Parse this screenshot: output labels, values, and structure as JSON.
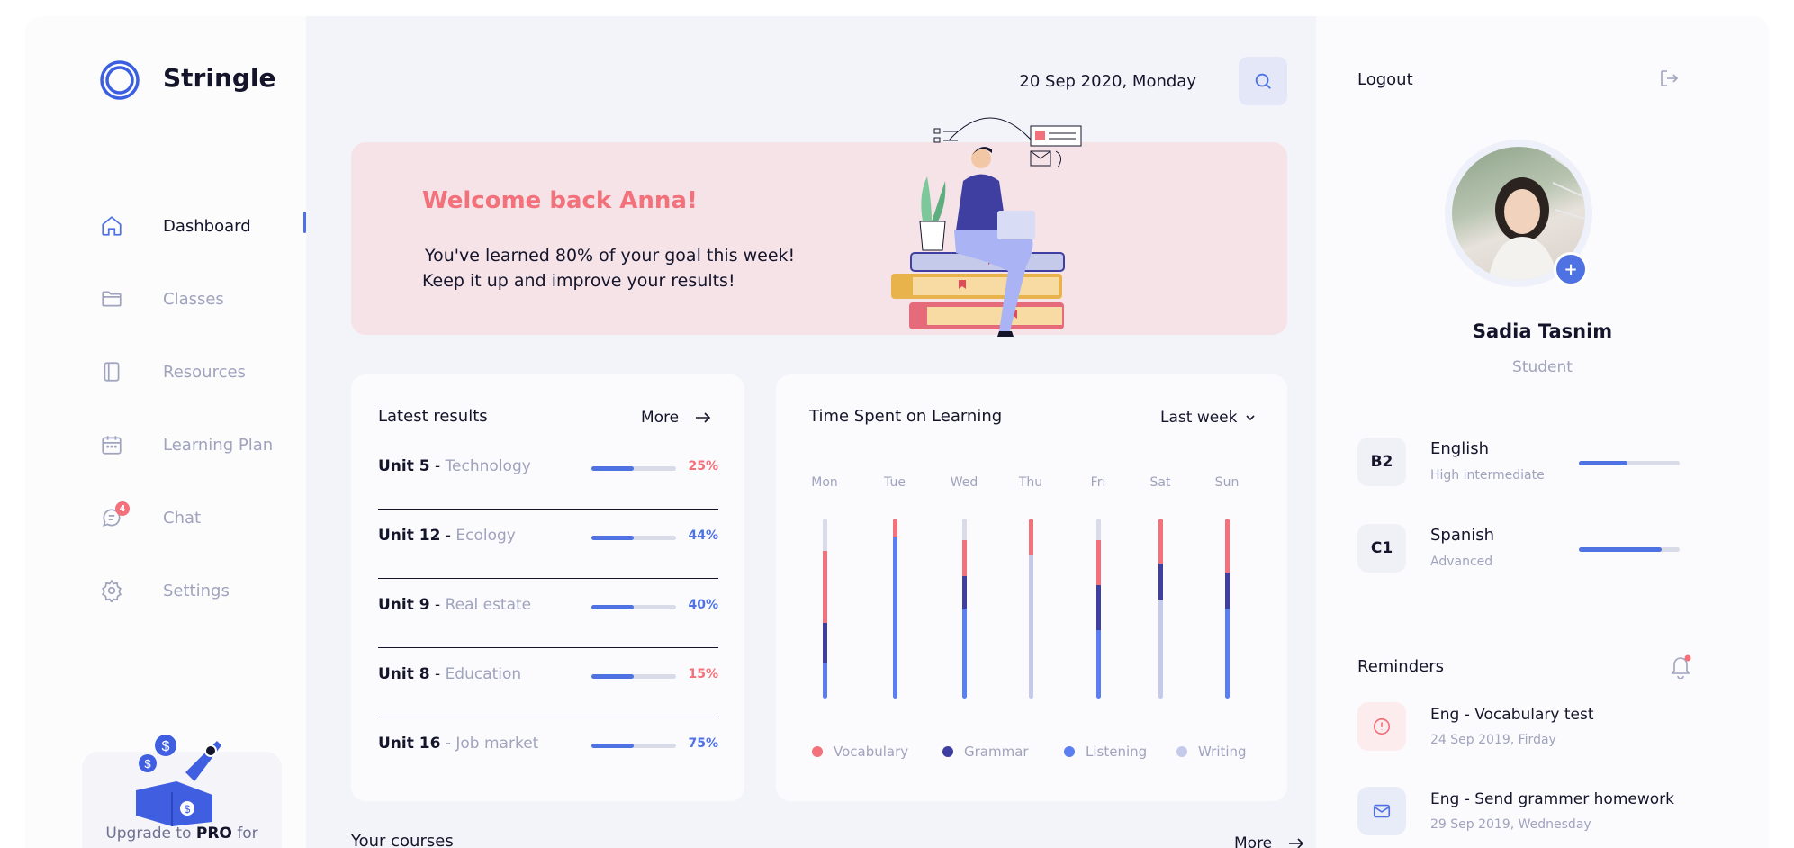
{
  "brand": {
    "name": "Stringle"
  },
  "sidebar": {
    "items": [
      {
        "label": "Dashboard",
        "icon": "home-icon",
        "active": true
      },
      {
        "label": "Classes",
        "icon": "folder-icon"
      },
      {
        "label": "Resources",
        "icon": "book-icon"
      },
      {
        "label": "Learning Plan",
        "icon": "calendar-icon"
      },
      {
        "label": "Chat",
        "icon": "chat-icon",
        "badge": "4"
      },
      {
        "label": "Settings",
        "icon": "gear-icon"
      }
    ],
    "upgrade": {
      "prefix": "Upgrade to",
      "pro": "PRO",
      "suffix": "for"
    }
  },
  "header": {
    "date": "20 Sep 2020, Monday",
    "search_icon": "search-icon"
  },
  "banner": {
    "title": "Welcome back Anna!",
    "line1": "You've learned 80% of your goal this week!",
    "line2": "Keep it up and improve your results!"
  },
  "results": {
    "title": "Latest results",
    "more": "More",
    "rows": [
      {
        "unit": "Unit 5",
        "topic": "Technology",
        "progress": 0.5,
        "pct": "25%",
        "color": "#f2717b"
      },
      {
        "unit": "Unit 12",
        "topic": "Ecology",
        "progress": 0.5,
        "pct": "44%",
        "color": "#4f72e3"
      },
      {
        "unit": "Unit 9",
        "topic": "Real estate",
        "progress": 0.5,
        "pct": "40%",
        "color": "#4f72e3"
      },
      {
        "unit": "Unit 8",
        "topic": "Education",
        "progress": 0.5,
        "pct": "15%",
        "color": "#f2717b"
      },
      {
        "unit": "Unit 16",
        "topic": "Job market",
        "progress": 0.5,
        "pct": "75%",
        "color": "#4f72e3"
      }
    ]
  },
  "time_chart": {
    "title": "Time Spent on Learning",
    "period": "Last week",
    "colors": {
      "Vocabulary": "#f2717b",
      "Grammar": "#3f3ea1",
      "Listening": "#5b7ef0",
      "Writing": "#c5c9ea",
      "Empty": "#d9dbe9"
    }
  },
  "chart_data": {
    "type": "bar",
    "categories": [
      "Mon",
      "Tue",
      "Wed",
      "Thu",
      "Fri",
      "Sat",
      "Sun"
    ],
    "series": [
      {
        "name": "Vocabulary",
        "values": [
          0.4,
          0.1,
          0.2,
          0.2,
          0.25,
          0.25,
          0.3
        ]
      },
      {
        "name": "Grammar",
        "values": [
          0.22,
          0,
          0.18,
          0,
          0.25,
          0.2,
          0.2
        ]
      },
      {
        "name": "Listening",
        "values": [
          0.2,
          0.9,
          0.5,
          0,
          0.38,
          0,
          0.5
        ]
      },
      {
        "name": "Writing",
        "values": [
          0,
          0,
          0,
          0.8,
          0,
          0.55,
          0
        ]
      }
    ],
    "stacking": "bottom-up: Listening, Writing, Grammar, Vocabulary; remainder grey"
  },
  "legend": [
    "Vocabulary",
    "Grammar",
    "Listening",
    "Writing"
  ],
  "courses": {
    "title": "Your courses",
    "more": "More"
  },
  "profile": {
    "logout": "Logout",
    "name": "Sadia Tasnim",
    "role": "Student",
    "languages": [
      {
        "badge": "B2",
        "name": "English",
        "level": "High intermediate",
        "progress": 0.48
      },
      {
        "badge": "C1",
        "name": "Spanish",
        "level": "Advanced",
        "progress": 0.82
      }
    ]
  },
  "reminders": {
    "title": "Reminders",
    "items": [
      {
        "title": "Eng - Vocabulary test",
        "date": "24 Sep 2019, Firday",
        "icon": "alert-icon",
        "bg": "#fdecee",
        "color": "#f2717b"
      },
      {
        "title": "Eng - Send grammer homework",
        "date": "29 Sep 2019, Wednesday",
        "icon": "mail-icon",
        "bg": "#e8ecf9",
        "color": "#4f72e3"
      }
    ]
  }
}
